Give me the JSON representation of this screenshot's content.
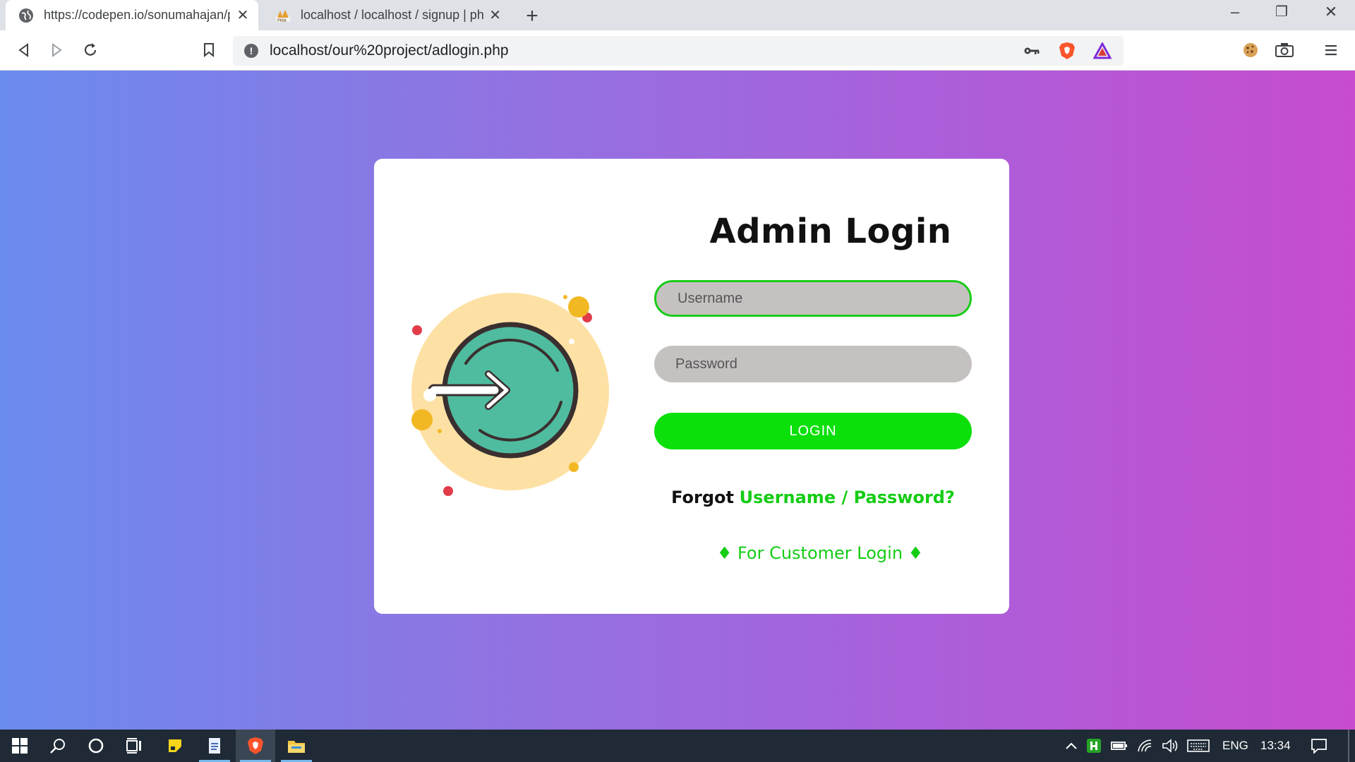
{
  "browser": {
    "tabs": [
      {
        "title": "https://codepen.io/sonumahajan/pen",
        "active": true
      },
      {
        "title": "localhost / localhost / signup | phpMyAdmin",
        "active": false
      }
    ],
    "new_tab_icon": "plus-icon",
    "window_controls": {
      "minimize": "–",
      "restore": "❐",
      "close": "✕"
    },
    "address": "localhost/our%20project/adlogin.php",
    "accent_colors": {
      "brave": "#fb542b",
      "rewards": "#7f2bd9"
    }
  },
  "login": {
    "title": "Admin Login",
    "username_placeholder": "Username",
    "password_placeholder": "Password",
    "login_label": "LOGIN",
    "forgot_prefix": "Forgot",
    "forgot_link": "Username / Password?",
    "customer_link": "♦ For Customer Login ♦",
    "colors": {
      "accent": "#0be00b",
      "input_bg": "#c6c1c1",
      "gradient_start": "#6a8bee",
      "gradient_end": "#c74ccf"
    }
  },
  "taskbar": {
    "language": "ENG",
    "time": "13:34"
  }
}
